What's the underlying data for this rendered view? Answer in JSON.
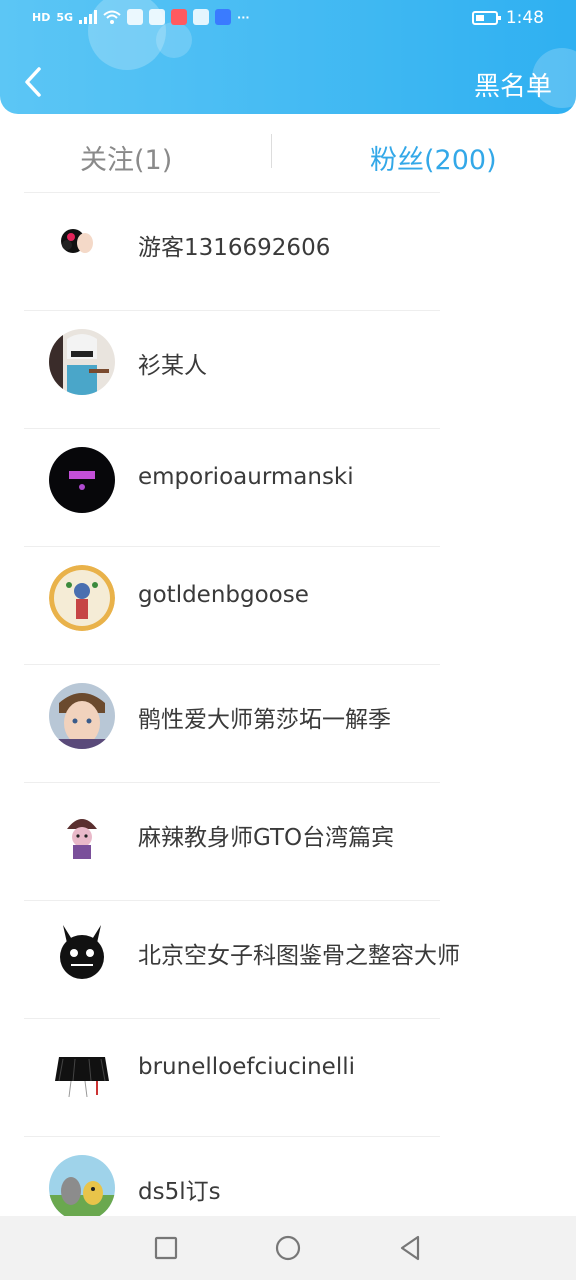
{
  "status_bar": {
    "network_label": "HD",
    "signal_label": "5G",
    "more": "···",
    "time": "1:48"
  },
  "header": {
    "back_icon": "chevron-left-icon",
    "blacklist_label": "黑名单"
  },
  "tabs": {
    "following_label": "关注(1)",
    "followers_label": "粉丝(200)",
    "active": "followers"
  },
  "followers": [
    {
      "name": "游客1316692606"
    },
    {
      "name": "衫某人"
    },
    {
      "name": "emporioaurmanski"
    },
    {
      "name": "gotldenbgoose"
    },
    {
      "name": "鹘性爱大师第莎坧一解季"
    },
    {
      "name": "麻辣教身师GTO台湾篇宾"
    },
    {
      "name": "北京空女子科图鉴骨之整容大师"
    },
    {
      "name": "brunelloefciucinelli"
    },
    {
      "name": "ds5l订s"
    }
  ],
  "colors": {
    "header_start": "#5cc6f5",
    "header_end": "#2fb0f1",
    "tab_active": "#33a8e8",
    "tab_inactive": "#8a8a8a"
  },
  "nav_icons": [
    "square-icon",
    "circle-icon",
    "triangle-back-icon"
  ]
}
